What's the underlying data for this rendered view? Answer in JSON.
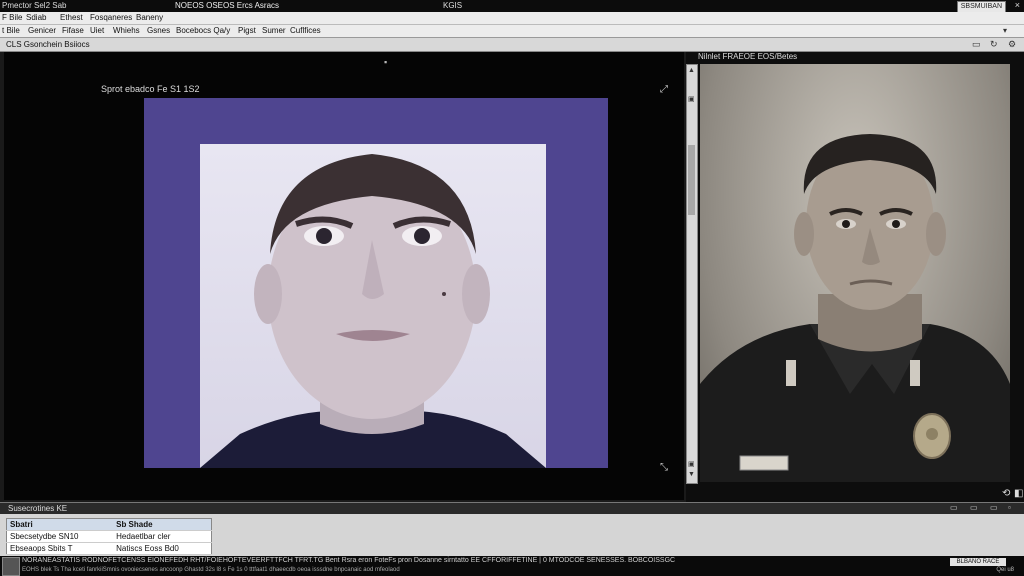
{
  "titlebar": {
    "left": "Pmector   Sel2 Sab",
    "center_title": "NOEOS OSEOS Ercs Asracs",
    "center_small": "KGIS",
    "right_button": "SBSMUIBAN",
    "close": "×"
  },
  "menubar": [
    "F Bile",
    "Sdiab",
    "Ethest",
    "Fosqaneres",
    "Baneny"
  ],
  "toolbar": {
    "items": [
      "t Bile",
      "Genicer",
      "Fifase",
      "Uiet",
      "Whiehs",
      "Gsnes",
      "Bocebocs Qa/y",
      "Pigst",
      "Sumer",
      "Cuflfices"
    ]
  },
  "pathbar": {
    "label": "CLS Gsonchein Bsiiocs"
  },
  "viewer": {
    "caption": "Sprot  ebadco  Fe S1 1S2"
  },
  "right_panel": {
    "title": "Nilnlet  FRAEOE EOS/Betes"
  },
  "bottom_panel": {
    "title": "Susecrotines KE",
    "table": {
      "headers": [
        "Sbatri",
        "Sb Shade"
      ],
      "rows": [
        [
          "Sbecsetydbe SN10",
          "Hedaetlbar cler"
        ],
        [
          "Ebseaops Sbits T",
          "Natiscs Eoss Bd0"
        ]
      ]
    }
  },
  "statusbar": {
    "line1": "NORANEASTATIS  RODNOFETCENSS  EIONEFEDH  RHT/FOIEHOFTEVEERFTTFCH   TFRT.TG  Bent   Rsra eron FoteFs pron  Dosanne  sirntatto  EE  CFFORIFFETINE    |  0  MTODCOE  SENESSES.  BOBCOISSGC",
    "line2": "EOHS  blek Ts   Tha kceti fanrkiiSmnis  ovooiecsenes  ancoonp Ghastd 32s  l8 s Fe 1s 0 tttfaat1  dhaeecdb oeoa  isssdne  bnpcanaic   aod  mfeolaod",
    "button": "BLBANO RACE",
    "right_small": "Qei   u8"
  }
}
